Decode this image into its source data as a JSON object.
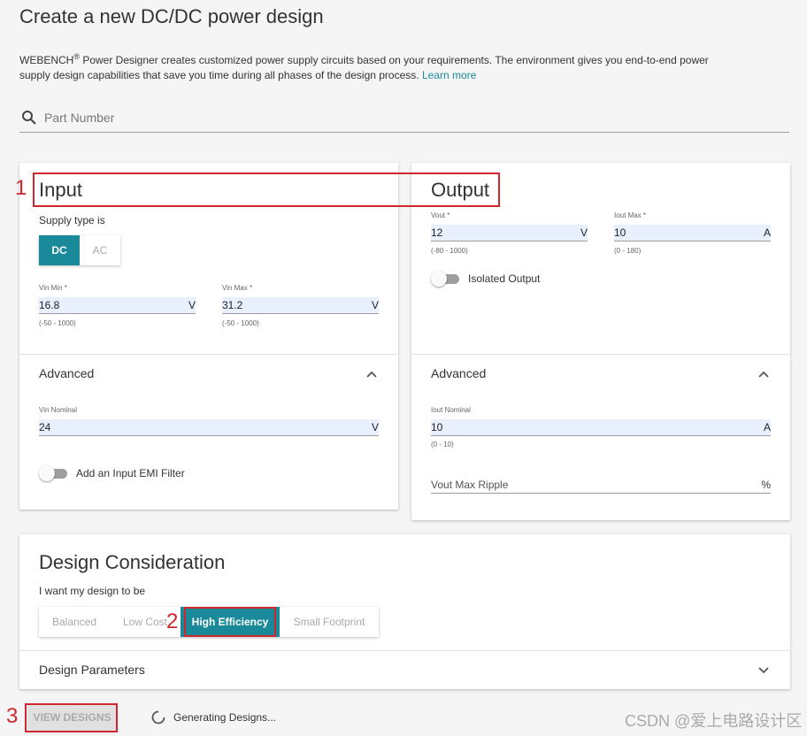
{
  "page": {
    "title": "Create a new DC/DC power design",
    "description_brand": "WEBENCH",
    "description_sup": "®",
    "description_text": " Power Designer creates customized power supply circuits based on your requirements. The environment gives you end-to-end power supply design capabilities that save you time during all phases of the design process. ",
    "learn_more": "Learn more"
  },
  "search": {
    "placeholder": "Part Number",
    "icon": "search-icon"
  },
  "input_card": {
    "title": "Input",
    "supply_type_label": "Supply type is",
    "supply_types": [
      "DC",
      "AC"
    ],
    "supply_type_selected": "DC",
    "vin_min": {
      "label": "Vin Min *",
      "value": "16.8",
      "unit": "V",
      "range": "(-50 - 1000)"
    },
    "vin_max": {
      "label": "Vin Max *",
      "value": "31.2",
      "unit": "V",
      "range": "(-50 - 1000)"
    },
    "advanced": "Advanced",
    "vin_nominal": {
      "label": "Vin Nominal",
      "value": "24",
      "unit": "V"
    },
    "emi_filter_label": "Add an Input EMI Filter",
    "emi_filter_on": false
  },
  "output_card": {
    "title": "Output",
    "vout": {
      "label": "Vout *",
      "value": "12",
      "unit": "V",
      "range": "(-80 - 1000)"
    },
    "iout_max": {
      "label": "Iout Max *",
      "value": "10",
      "unit": "A",
      "range": "(0 - 180)"
    },
    "isolated_label": "Isolated Output",
    "isolated_on": false,
    "advanced": "Advanced",
    "iout_nominal": {
      "label": "Iout Nominal",
      "value": "10",
      "unit": "A",
      "range": "(0 - 10)"
    },
    "vout_ripple": {
      "placeholder": "Vout Max Ripple",
      "unit": "%"
    }
  },
  "design_card": {
    "title": "Design Consideration",
    "prompt": "I want my design to be",
    "options": [
      "Balanced",
      "Low Cost",
      "High Efficiency",
      "Small Footprint"
    ],
    "selected": "High Efficiency",
    "parameters": "Design Parameters"
  },
  "footer": {
    "view_designs": "VIEW DESIGNS",
    "generating": "Generating Designs...",
    "watermark": "CSDN @爱上电路设计区"
  },
  "annotations": {
    "n1": "1",
    "n2": "2",
    "n3": "3",
    "color": "#d0262d"
  },
  "colors": {
    "accent": "#1a8a9a",
    "field_bg": "#e8f0fe"
  }
}
